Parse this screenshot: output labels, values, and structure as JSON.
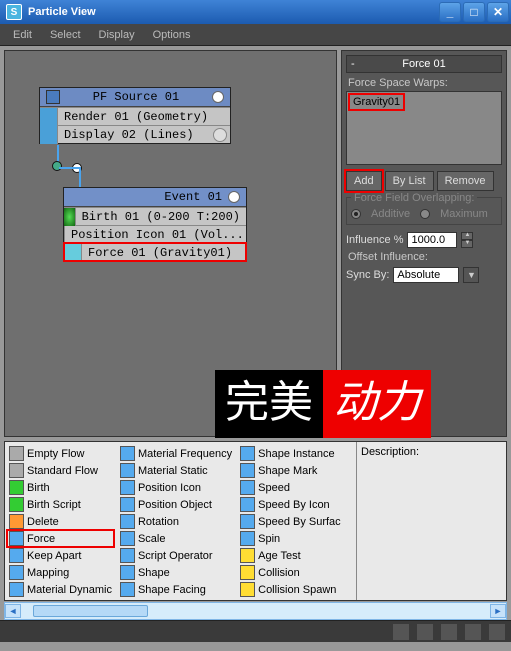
{
  "window": {
    "title": "Particle View"
  },
  "menu": {
    "edit": "Edit",
    "select": "Select",
    "display": "Display",
    "options": "Options"
  },
  "nodes": {
    "source": {
      "title": "PF Source 01",
      "rows": [
        {
          "label": "Render 01 (Geometry)"
        },
        {
          "label": "Display 02 (Lines)"
        }
      ]
    },
    "event": {
      "title": "Event 01",
      "rows": [
        {
          "label": "Birth 01 (0-200 T:200)"
        },
        {
          "label": "Position Icon 01 (Vol..."
        },
        {
          "label": "Force 01 (Gravity01)"
        }
      ]
    }
  },
  "panel": {
    "title": "Force 01",
    "spacewarps_label": "Force Space Warps:",
    "spacewarps": [
      "Gravity01"
    ],
    "btn_add": "Add",
    "btn_bylist": "By List",
    "btn_remove": "Remove",
    "overlap_label": "Force Field Overlapping:",
    "overlap_additive": "Additive",
    "overlap_maximum": "Maximum",
    "influence_label": "Influence %",
    "influence_value": "1000.0",
    "offset_label": "Offset Influence:",
    "sync_label": "Sync By:",
    "sync_value": "Absolute"
  },
  "depot": {
    "col1": [
      "Empty Flow",
      "Standard Flow",
      "Birth",
      "Birth Script",
      "Delete",
      "Force",
      "Keep Apart",
      "Mapping",
      "Material Dynamic"
    ],
    "col2": [
      "Material Frequency",
      "Material Static",
      "Position Icon",
      "Position Object",
      "Rotation",
      "Scale",
      "Script Operator",
      "Shape",
      "Shape Facing"
    ],
    "col3": [
      "Shape Instance",
      "Shape Mark",
      "Speed",
      "Speed By Icon",
      "Speed By Surfac",
      "Spin",
      "Age Test",
      "Collision",
      "Collision Spawn"
    ],
    "desc_label": "Description:"
  },
  "watermark": {
    "left": "完美",
    "right": "动力"
  }
}
